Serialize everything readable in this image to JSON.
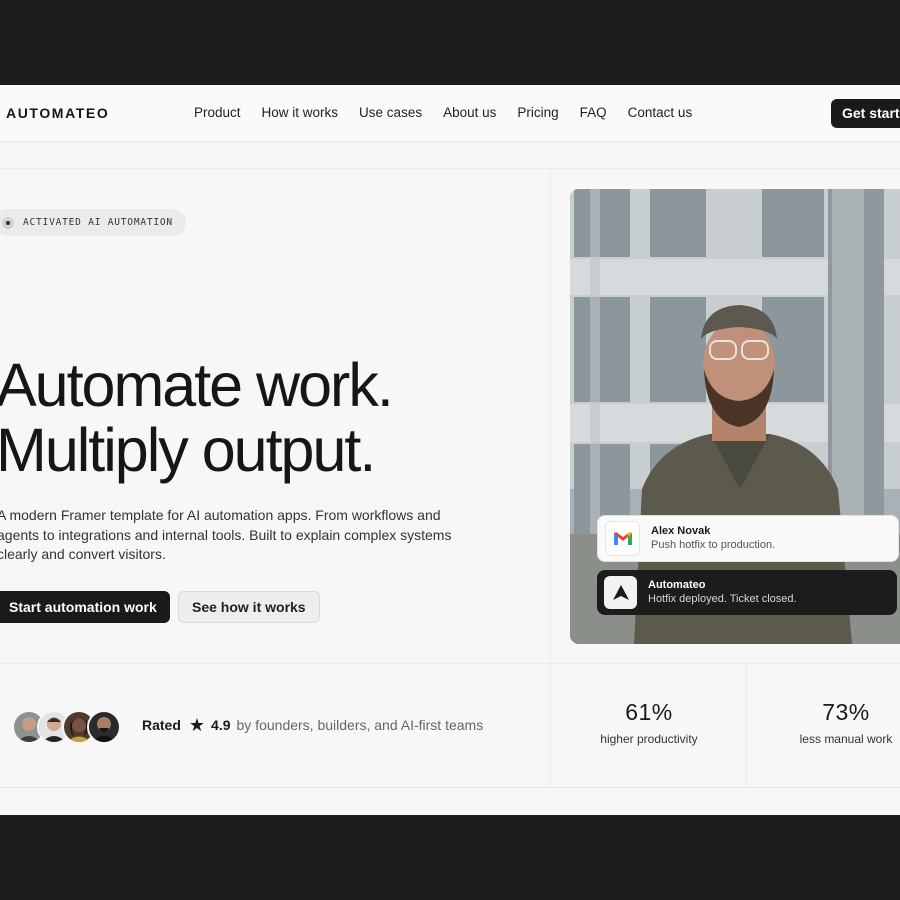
{
  "brand": {
    "name": "AUTOMATEO"
  },
  "nav": {
    "links": [
      "Product",
      "How it works",
      "Use cases",
      "About us",
      "Pricing",
      "FAQ",
      "Contact us"
    ],
    "cta": "Get starte"
  },
  "hero": {
    "badge": "ACTIVATED AI AUTOMATION",
    "headline_1": "Automate work.",
    "headline_2": "Multiply output.",
    "description": "A modern Framer template for AI automation apps. From workflows and agents to integrations and internal tools. Built to explain complex systems clearly and convert visitors.",
    "primary_button": "Start automation work",
    "secondary_button": "See how it works"
  },
  "notifications": [
    {
      "sender": "Alex Novak",
      "message": "Push hotfix to production.",
      "icon": "gmail-icon"
    },
    {
      "sender": "Automateo",
      "message": "Hotfix deployed. Ticket closed.",
      "icon": "automateo-logo-icon"
    }
  ],
  "social_proof": {
    "rated_label": "Rated",
    "star_icon": "star-icon",
    "rating": "4.9",
    "rating_text": "by founders, builders, and AI-first teams"
  },
  "stats": [
    {
      "value": "61%",
      "label": "higher productivity"
    },
    {
      "value": "73%",
      "label": "less manual work"
    }
  ],
  "colors": {
    "accent": "#1a1a1a",
    "background": "#f7f7f7",
    "outer": "#1d1d1d"
  }
}
